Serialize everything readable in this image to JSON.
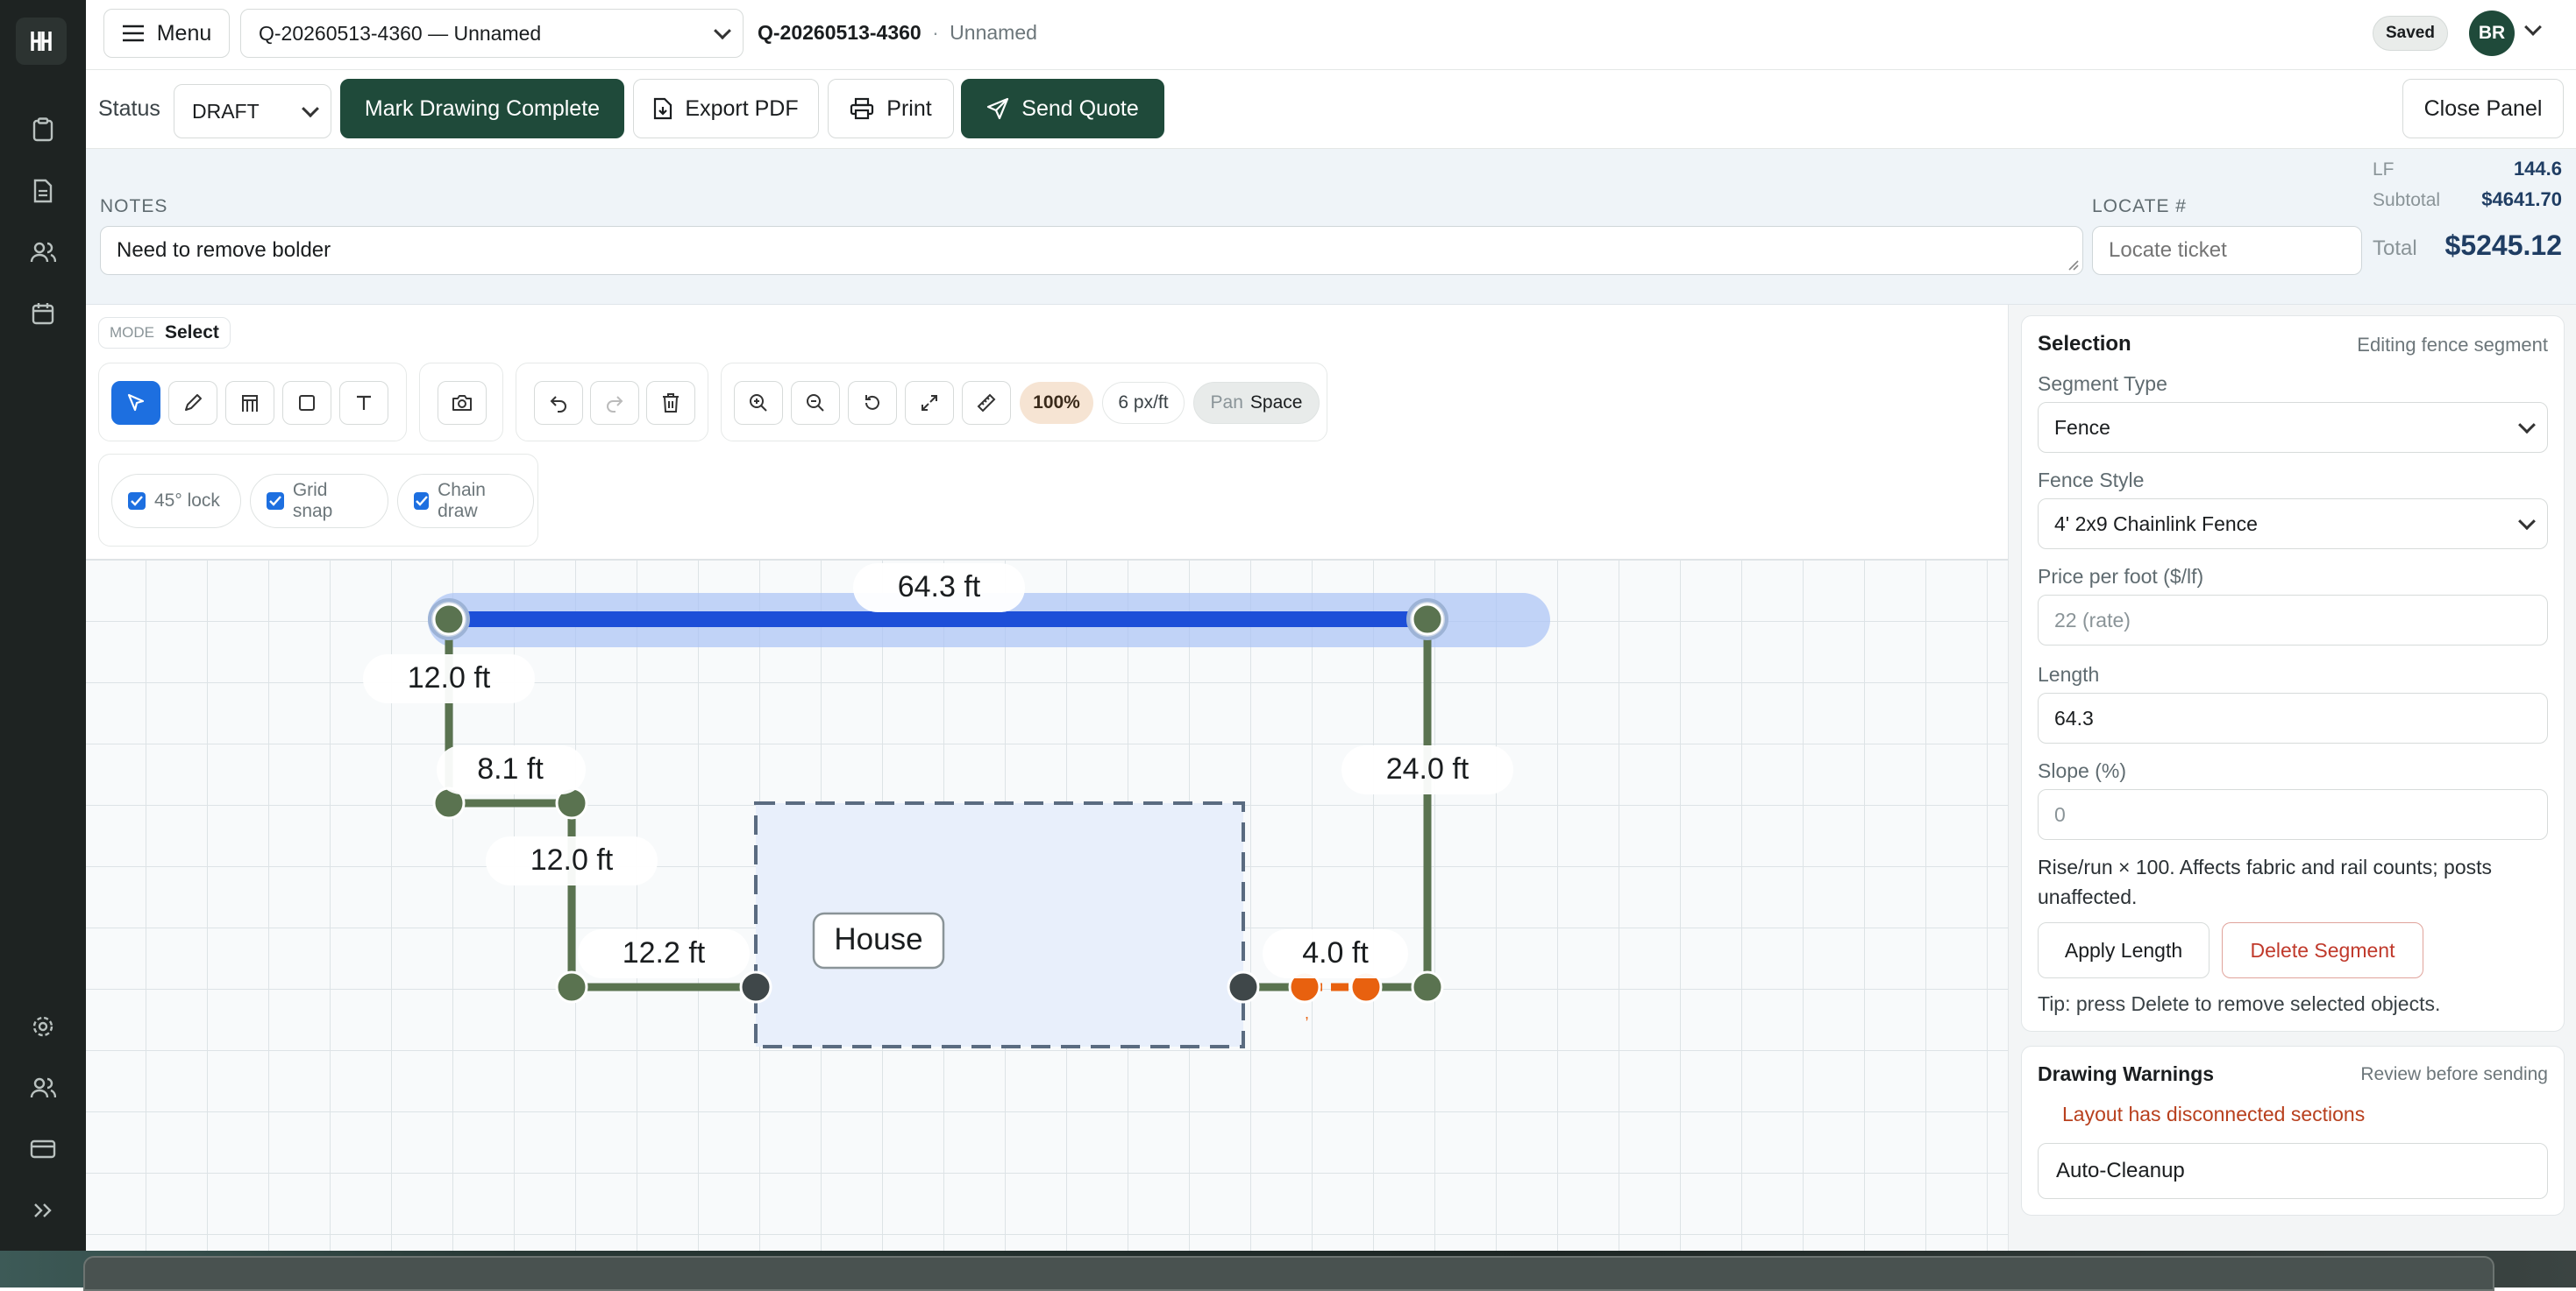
{
  "topbar": {
    "menu_label": "Menu",
    "project_select": "Q-20260513-4360 — Unnamed",
    "quote_id": "Q-20260513-4360",
    "separator": "·",
    "quote_name": "Unnamed",
    "saved_badge": "Saved",
    "avatar_initials": "BR"
  },
  "actions": {
    "status_label": "Status",
    "status_value": "DRAFT",
    "mark_complete": "Mark Drawing Complete",
    "export_pdf": "Export PDF",
    "print": "Print",
    "send_quote": "Send Quote",
    "close_panel": "Close Panel"
  },
  "notes": {
    "label": "NOTES",
    "value": "Need to remove bolder",
    "locate_label": "LOCATE #",
    "locate_placeholder": "Locate ticket"
  },
  "totals": {
    "lf_label": "LF",
    "lf_value": "144.6",
    "subtotal_label": "Subtotal",
    "subtotal_value": "$4641.70",
    "total_label": "Total",
    "total_value": "$5245.12"
  },
  "mode": {
    "label": "MODE",
    "value": "Select"
  },
  "tools": {
    "zoom_level": "100%",
    "scale": "6 px/ft",
    "pan_label": "Pan",
    "pan_key": "Space"
  },
  "options": {
    "lock45": "45° lock",
    "grid_snap": "Grid snap",
    "chain_draw": "Chain draw"
  },
  "drawing": {
    "labels": [
      "64.3 ft",
      "12.0 ft",
      "8.1 ft",
      "12.0 ft",
      "12.2 ft",
      "24.0 ft",
      "4.0 ft"
    ],
    "house_label": "House",
    "fence_color": "#5a7350",
    "selected_color": "#1d4fd8",
    "gate_color": "#e8610f"
  },
  "panel": {
    "title": "Selection",
    "subtitle": "Editing fence segment",
    "segment_type_label": "Segment Type",
    "segment_type_value": "Fence",
    "fence_style_label": "Fence Style",
    "fence_style_value": "4' 2x9 Chainlink Fence",
    "price_label": "Price per foot ($/lf)",
    "price_placeholder": "22 (rate)",
    "length_label": "Length",
    "length_value": "64.3",
    "slope_label": "Slope (%)",
    "slope_placeholder": "0",
    "slope_help": "Rise/run × 100. Affects fabric and rail counts; posts unaffected.",
    "apply_length": "Apply Length",
    "delete_segment": "Delete Segment",
    "tip": "Tip: press Delete to remove selected objects."
  },
  "warnings": {
    "title": "Drawing Warnings",
    "subtitle": "Review before sending",
    "message": "Layout has disconnected sections",
    "auto_cleanup": "Auto-Cleanup"
  }
}
